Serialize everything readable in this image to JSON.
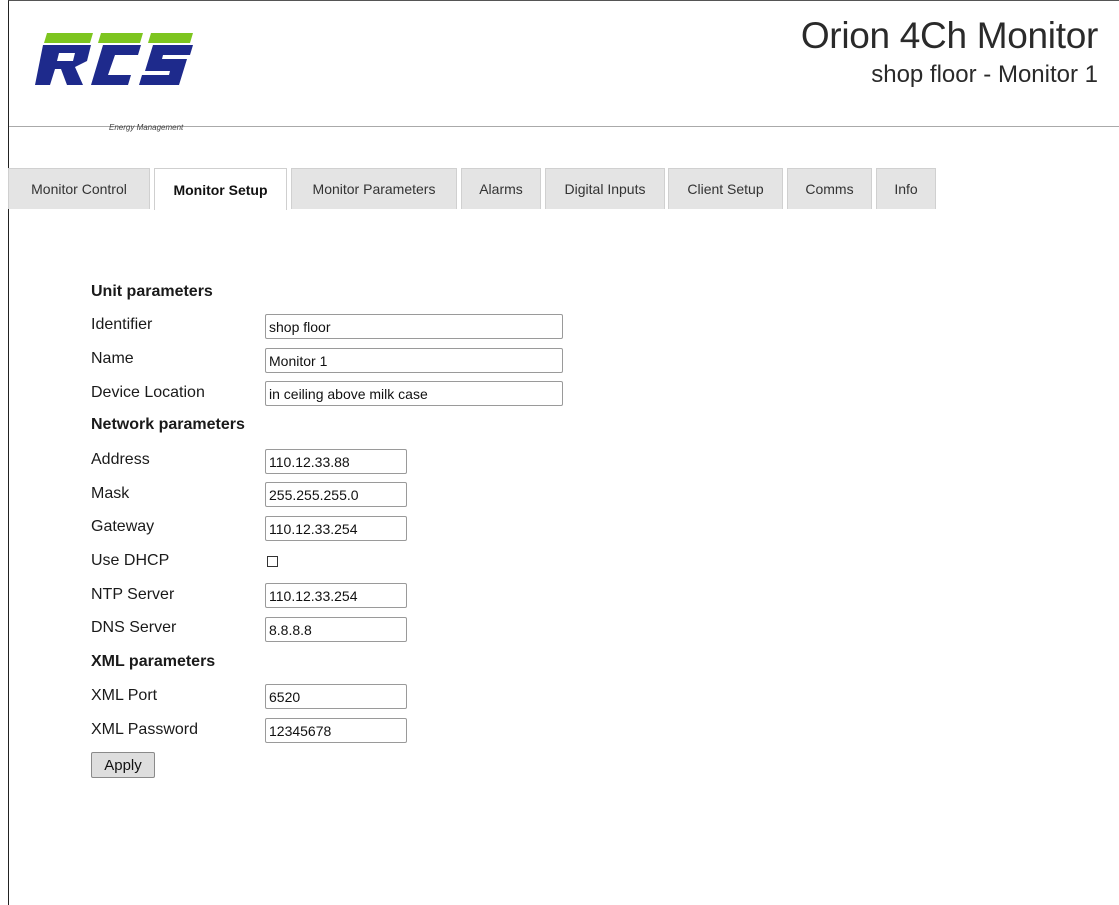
{
  "header": {
    "logo_text": "RCS",
    "logo_tagline": "Energy Management",
    "title": "Orion 4Ch Monitor",
    "subtitle": "shop floor - Monitor 1",
    "colors": {
      "logo_green": "#7dc51f",
      "logo_blue": "#1e2a8c"
    }
  },
  "tabs": [
    {
      "label": "Monitor Control",
      "active": false
    },
    {
      "label": "Monitor Setup",
      "active": true
    },
    {
      "label": "Monitor Parameters",
      "active": false
    },
    {
      "label": "Alarms",
      "active": false
    },
    {
      "label": "Digital Inputs",
      "active": false
    },
    {
      "label": "Client Setup",
      "active": false
    },
    {
      "label": "Comms",
      "active": false
    },
    {
      "label": "Info",
      "active": false
    }
  ],
  "unit": {
    "section_title": "Unit parameters",
    "identifier_label": "Identifier",
    "identifier_value": "shop floor",
    "name_label": "Name",
    "name_value": "Monitor 1",
    "location_label": "Device Location",
    "location_value": "in ceiling above milk case"
  },
  "network": {
    "section_title": "Network parameters",
    "address_label": "Address",
    "address_value": "110.12.33.88",
    "mask_label": "Mask",
    "mask_value": "255.255.255.0",
    "gateway_label": "Gateway",
    "gateway_value": "110.12.33.254",
    "dhcp_label": "Use DHCP",
    "dhcp_checked": false,
    "ntp_label": "NTP Server",
    "ntp_value": "110.12.33.254",
    "dns_label": "DNS Server",
    "dns_value": "8.8.8.8"
  },
  "xml": {
    "section_title": "XML parameters",
    "port_label": "XML Port",
    "port_value": "6520",
    "password_label": "XML Password",
    "password_value": "12345678"
  },
  "actions": {
    "apply_label": "Apply"
  }
}
